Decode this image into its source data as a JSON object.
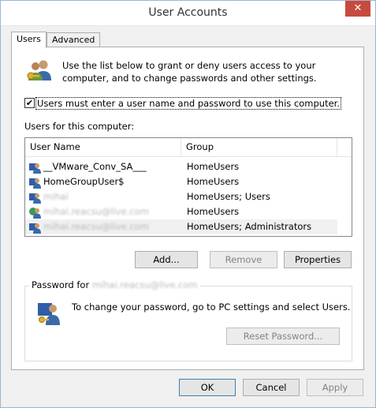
{
  "window": {
    "title": "User Accounts",
    "close_glyph": "✕"
  },
  "tabs": [
    {
      "label": "Users"
    },
    {
      "label": "Advanced"
    }
  ],
  "intro": {
    "text": "Use the list below to grant or deny users access to your computer, and to change passwords and other settings."
  },
  "require_login": {
    "checked": true,
    "mark": "✔",
    "label": "Users must enter a user name and password to use this computer."
  },
  "users_label": "Users for this computer:",
  "list": {
    "columns": {
      "name": "User Name",
      "group": "Group"
    },
    "rows": [
      {
        "name": "__VMware_Conv_SA___",
        "group": "HomeUsers",
        "blurred": false
      },
      {
        "name": "HomeGroupUser$",
        "group": "HomeUsers",
        "blurred": false
      },
      {
        "name": "mihai",
        "group": "HomeUsers; Users",
        "blurred": true
      },
      {
        "name": "mihai.reacsu@live.com",
        "group": "HomeUsers",
        "blurred": true
      },
      {
        "name": "mihai.reacsu@live.com",
        "group": "HomeUsers; Administrators",
        "blurred": true,
        "selected": true
      }
    ]
  },
  "buttons": {
    "add": "Add...",
    "remove": "Remove",
    "properties": "Properties",
    "reset_password": "Reset Password...",
    "ok": "OK",
    "cancel": "Cancel",
    "apply": "Apply"
  },
  "password_group": {
    "caption": "Password for",
    "user": "mihai.reacsu@live.com",
    "text": "To change your password, go to PC settings and select Users."
  },
  "colors": {
    "close_button": "#c74a3f",
    "window_border": "#9ab6d4",
    "default_button_border": "#3c7fb1"
  },
  "icons": {
    "intro": "users-keys-icon",
    "user_row": "user-icon",
    "password": "user-key-icon"
  }
}
